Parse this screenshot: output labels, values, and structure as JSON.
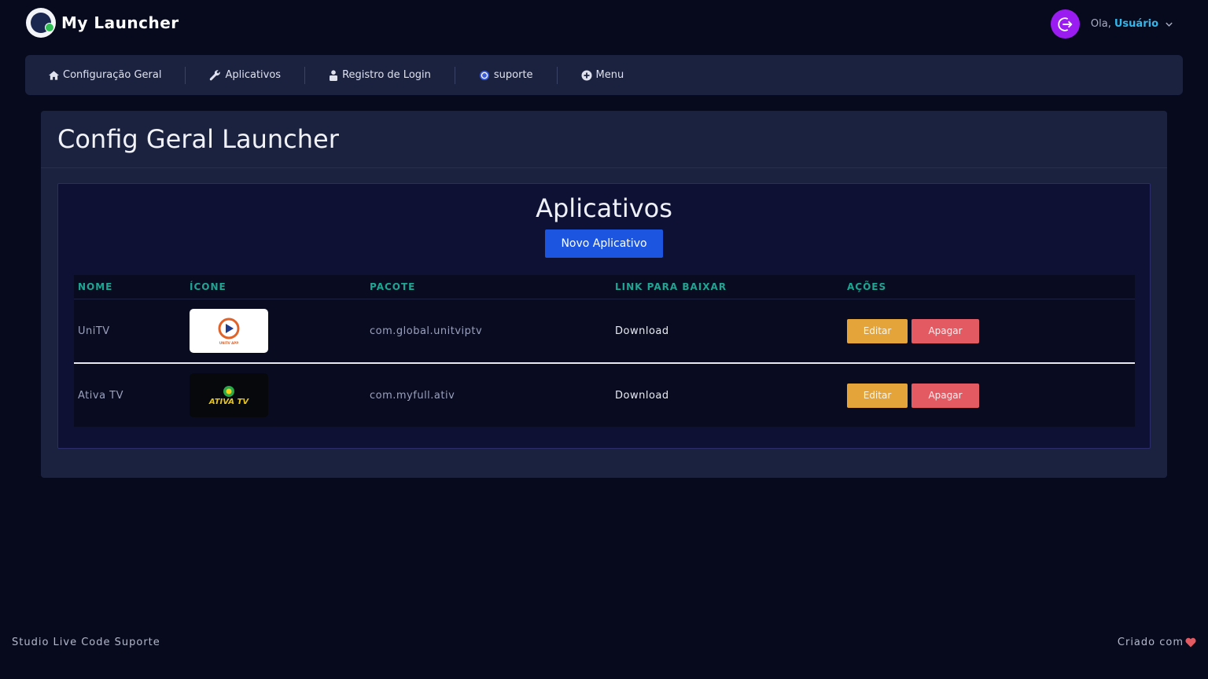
{
  "brand": {
    "name": "My Launcher"
  },
  "user": {
    "greeting": "Ola,",
    "name": "Usuário"
  },
  "nav": {
    "items": [
      {
        "label": "Configuração Geral",
        "icon": "home-icon"
      },
      {
        "label": "Aplicativos",
        "icon": "wrench-icon"
      },
      {
        "label": "Registro de Login",
        "icon": "user-lock-icon"
      },
      {
        "label": "suporte",
        "icon": "whatsapp-icon"
      },
      {
        "label": "Menu",
        "icon": "plus-circle-icon"
      }
    ]
  },
  "page": {
    "title": "Config Geral Launcher"
  },
  "apps_section": {
    "title": "Aplicativos",
    "new_button": "Novo Aplicativo",
    "columns": {
      "name": "NOME",
      "icon": "ÍCONE",
      "package": "PACOTE",
      "link": "LINK PARA BAIXAR",
      "actions": "AÇÕES"
    },
    "rows": [
      {
        "name": "UniTV",
        "icon_text": "UNITV APP",
        "package": "com.global.unitviptv",
        "link": "Download",
        "edit": "Editar",
        "delete": "Apagar"
      },
      {
        "name": "Ativa TV",
        "icon_text": "ATIVA TV",
        "package": "com.myfull.ativ",
        "link": "Download",
        "edit": "Editar",
        "delete": "Apagar"
      }
    ]
  },
  "footer": {
    "left": "Studio Live Code Suporte",
    "right": "Criado com"
  },
  "colors": {
    "primary": "#1c55e0",
    "edit": "#e4a43a",
    "delete": "#e35a62",
    "accent_user": "#33b6ea",
    "avatar": "#9a1cf0",
    "header_teal": "#1fa592"
  }
}
